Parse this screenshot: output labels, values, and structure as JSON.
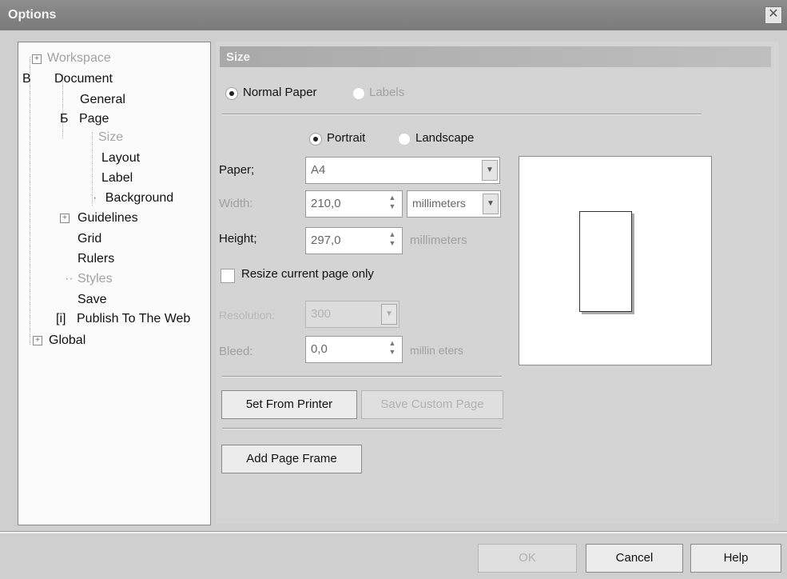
{
  "window": {
    "title": "Options",
    "close_symbol": "✕"
  },
  "tree": {
    "items": [
      {
        "label": "Workspace",
        "state": "collapsed"
      },
      {
        "label": "Document",
        "prefix": "B"
      },
      {
        "label": "General"
      },
      {
        "label": "Page",
        "prefix": "Б"
      },
      {
        "label": "Size",
        "selected": true
      },
      {
        "label": "Layout"
      },
      {
        "label": "Label"
      },
      {
        "label": "Background"
      },
      {
        "label": "Guidelines",
        "state": "collapsed"
      },
      {
        "label": "Grid"
      },
      {
        "label": "Rulers"
      },
      {
        "label": "Styles",
        "prefix": "··"
      },
      {
        "label": "Save"
      },
      {
        "label": "Publish To The Web",
        "prefix": "[i]"
      },
      {
        "label": "Global",
        "state": "collapsed"
      }
    ]
  },
  "section": {
    "title": "Size",
    "paper_type": {
      "options": [
        "Normal Paper",
        "Labels"
      ],
      "selected": "Normal Paper"
    },
    "orientation": {
      "options": [
        "Portrait",
        "Landscape"
      ],
      "selected": "Portrait"
    },
    "fields": {
      "paper": {
        "label": "Paper;",
        "value": "A4"
      },
      "width": {
        "label": "Width:",
        "value": "210,0",
        "unit": "millimeters"
      },
      "height": {
        "label": "Height;",
        "value": "297,0",
        "unit": "millimeters"
      },
      "resize_label": "Resize current page only",
      "resolution": {
        "label": "Resolution:",
        "value": "300"
      },
      "bleed": {
        "label": "Bleed:",
        "value": "0,0",
        "unit": "millin eters"
      }
    },
    "buttons": {
      "set_from_printer": "5et From Printer",
      "save_custom_page": "Save Custom Page",
      "add_page_frame": "Add Page Frame"
    }
  },
  "dialog_buttons": {
    "ok": "OK",
    "cancel": "Cancel",
    "help": "Help"
  }
}
